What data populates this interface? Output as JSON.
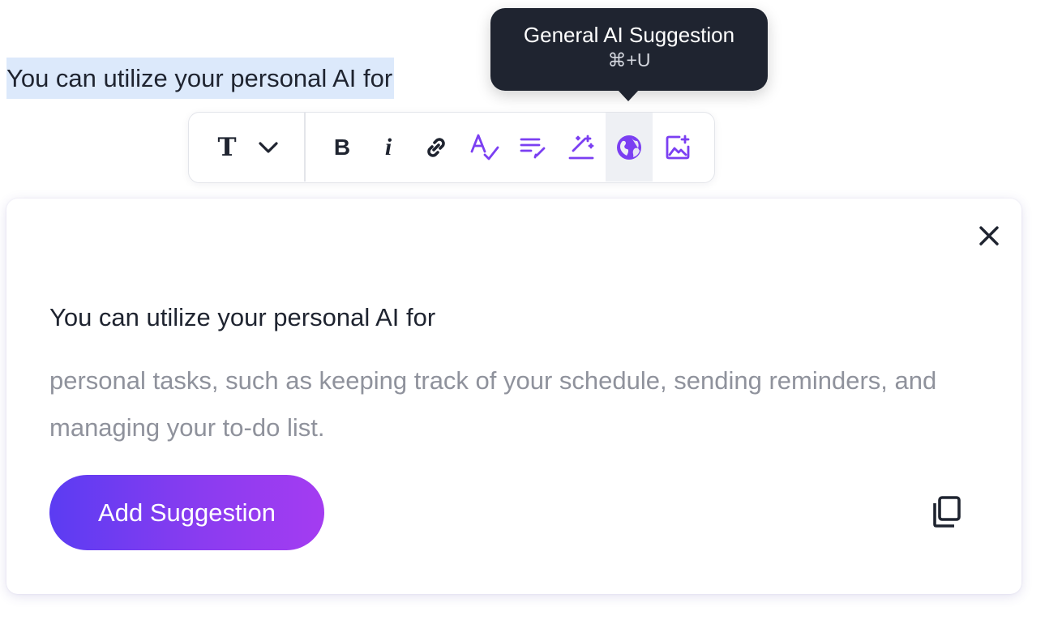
{
  "editor": {
    "selected_text": "You can utilize your personal AI for"
  },
  "tooltip": {
    "title": "General AI Suggestion",
    "shortcut": "⌘+U"
  },
  "toolbar": {
    "text_style_label": "T",
    "bold_label": "B",
    "italic_label": "i",
    "accent_color": "#7b3ff2",
    "icons": [
      "chevron-down-icon",
      "link-icon",
      "spellcheck-icon",
      "rewrite-icon",
      "magic-wand-icon",
      "globe-icon",
      "ai-image-icon"
    ],
    "active_tool": "globe-icon"
  },
  "suggestion": {
    "heading": "You can utilize your personal AI for",
    "body": "personal tasks, such as keeping track of your schedule, sending reminders, and managing your to-do list.",
    "add_button_label": "Add Suggestion",
    "button_gradient": [
      "#5b3cf2",
      "#a43cf1"
    ],
    "close_icon": "close-icon",
    "copy_icon": "copy-icon"
  }
}
